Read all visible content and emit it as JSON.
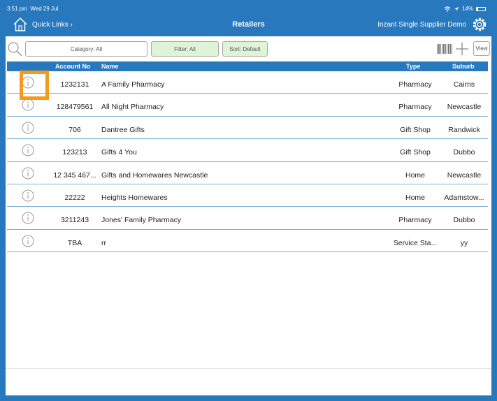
{
  "status_bar": {
    "time": "3:51 pm",
    "date": "Wed 29 Jul",
    "battery": "14%"
  },
  "nav": {
    "quick_links": "Quick Links ›",
    "title": "Retailers",
    "account": "Inzant Single Supplier Demo"
  },
  "toolbar": {
    "category": "Category: All",
    "filter": "Filter: All",
    "sort": "Sort: Default",
    "view": "View"
  },
  "table": {
    "headers": {
      "account": "Account No",
      "name": "Name",
      "type": "Type",
      "suburb": "Suburb"
    },
    "rows": [
      {
        "account": "1232131",
        "name": "A Family Pharmacy",
        "type": "Pharmacy",
        "suburb": "Cairns"
      },
      {
        "account": "128479561",
        "name": "All Night Pharmacy",
        "type": "Pharmacy",
        "suburb": "Newcastle"
      },
      {
        "account": "706",
        "name": "Dantree Gifts",
        "type": "Gift Shop",
        "suburb": "Randwick"
      },
      {
        "account": "123213",
        "name": "Gifts 4 You",
        "type": "Gift Shop",
        "suburb": "Dubbo"
      },
      {
        "account": "12 345 467...",
        "name": "Gifts and Homewares Newcastle",
        "type": "Home",
        "suburb": "Newcastle"
      },
      {
        "account": "22222",
        "name": "Heights Homewares",
        "type": "Home",
        "suburb": "Adamstow..."
      },
      {
        "account": "3211243",
        "name": "Jones' Family Pharmacy",
        "type": "Pharmacy",
        "suburb": "Dubbo"
      },
      {
        "account": "TBA",
        "name": "rr",
        "type": "Service Sta...",
        "suburb": "yy"
      }
    ]
  },
  "colors": {
    "brand": "#2878be",
    "highlight": "#f59a1b",
    "filter_bg": "#dff4d7",
    "row_divider": "#7fb0d6"
  }
}
